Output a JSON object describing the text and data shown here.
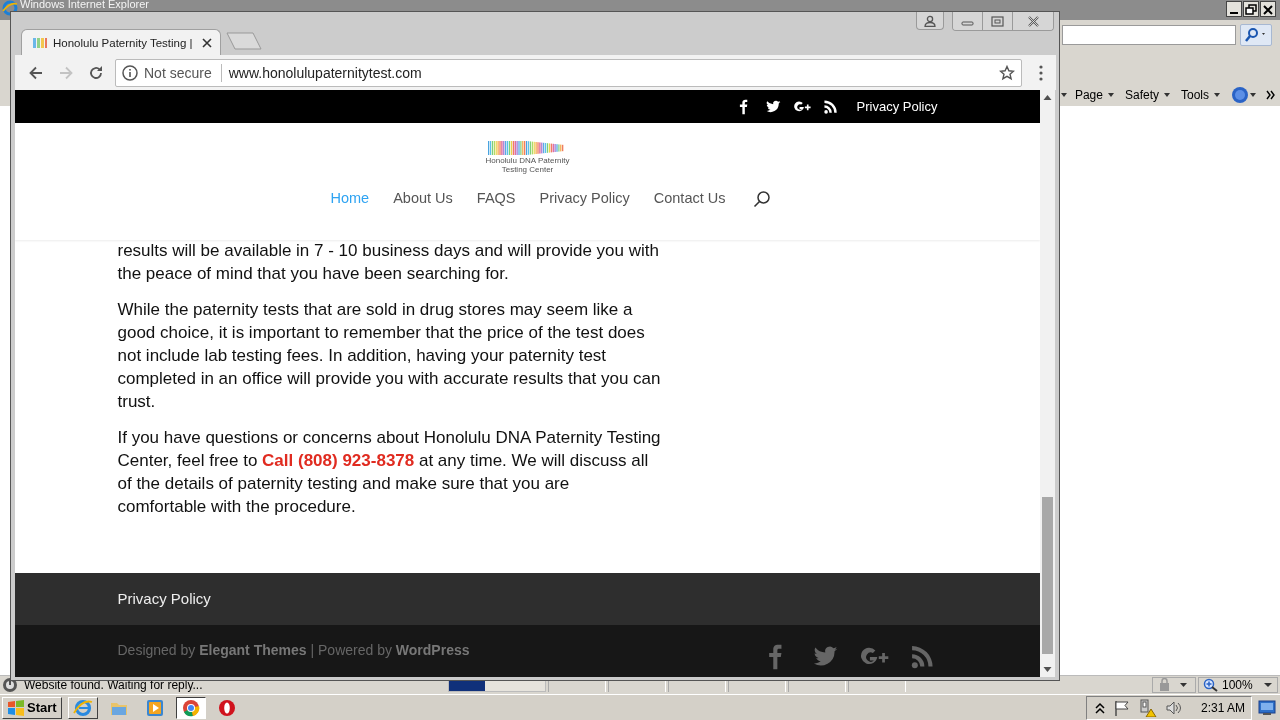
{
  "ie_window": {
    "title": "Windows Internet Explorer",
    "command_bar": [
      {
        "kind": "menu",
        "label": "Page"
      },
      {
        "kind": "menu",
        "label": "Safety"
      },
      {
        "kind": "menu",
        "label": "Tools"
      },
      {
        "kind": "help"
      }
    ],
    "status_bar": {
      "text": "Website found. Waiting for reply...",
      "progress": {
        "level": 0.37
      },
      "zoom": "100%"
    }
  },
  "chrome_window": {
    "tabs": [
      {
        "title": "Honolulu Paternity Testing |",
        "selected": true
      }
    ],
    "nav_buttons": [
      {
        "kind": "back",
        "disabled": false
      },
      {
        "kind": "forward",
        "disabled": true
      },
      {
        "kind": "reload",
        "disabled": false
      }
    ],
    "omnibox": {
      "security": "Not secure",
      "url": "www.honolulupaternitytest.com"
    }
  },
  "page": {
    "top_bar": {
      "social": [
        {
          "kind": "facebook"
        },
        {
          "kind": "twitter"
        },
        {
          "kind": "google-plus"
        },
        {
          "kind": "rss"
        }
      ],
      "link": "Privacy Policy"
    },
    "logo": {
      "line_1": "Honolulu DNA Paternity",
      "line_2": "Testing Center"
    },
    "nav": [
      {
        "label": "Home",
        "selected": true
      },
      {
        "label": "About Us",
        "selected": false
      },
      {
        "label": "FAQS",
        "selected": false
      },
      {
        "label": "Privacy Policy",
        "selected": false
      },
      {
        "label": "Contact Us",
        "selected": false
      }
    ],
    "paragraphs": [
      {
        "segments": [
          {
            "kind": "text",
            "text": "results will be available in 7 - 10 business days and will provide you with the peace of mind that you have been searching for."
          }
        ]
      },
      {
        "segments": [
          {
            "kind": "text",
            "text": "While the paternity tests that are sold in drug stores may seem like a good choice, it is important to remember that the price of the test does not include lab testing fees. In addition, having your paternity test completed in an office will provide you with accurate results that you can trust."
          }
        ]
      },
      {
        "segments": [
          {
            "kind": "text",
            "text": "If you have questions or concerns about Honolulu DNA Paternity Testing Center, feel free to "
          },
          {
            "kind": "link",
            "text": "Call (808) 923-8378"
          },
          {
            "kind": "text",
            "text": " at any time. We will discuss all of the details of paternity testing and make sure that you are comfortable with the procedure."
          }
        ]
      }
    ],
    "footer": {
      "menu": [
        "Privacy Policy"
      ],
      "credits": "Designed by **Elegant Themes** | Powered by **WordPress**",
      "social": [
        {
          "kind": "facebook"
        },
        {
          "kind": "twitter"
        },
        {
          "kind": "google-plus"
        },
        {
          "kind": "rss"
        }
      ]
    }
  },
  "taskbar": {
    "start": "Start",
    "apps": [
      {
        "kind": "ie",
        "open": true,
        "selected": false
      },
      {
        "kind": "folder",
        "open": false,
        "selected": false
      },
      {
        "kind": "media",
        "open": false,
        "selected": false
      },
      {
        "kind": "chrome",
        "open": true,
        "selected": true
      },
      {
        "kind": "opera",
        "open": false,
        "selected": false
      }
    ],
    "clock": "2:31 AM"
  }
}
